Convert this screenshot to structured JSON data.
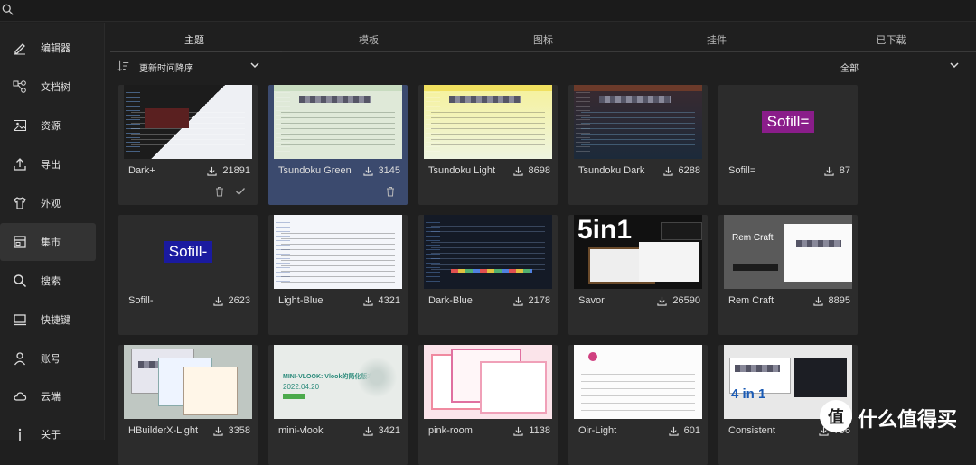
{
  "sidebar": {
    "items": [
      {
        "label": "编辑器",
        "icon": "edit-icon"
      },
      {
        "label": "文档树",
        "icon": "tree-icon"
      },
      {
        "label": "资源",
        "icon": "image-icon"
      },
      {
        "label": "导出",
        "icon": "export-icon"
      },
      {
        "label": "外观",
        "icon": "appearance-icon"
      },
      {
        "label": "集市",
        "icon": "market-icon",
        "active": true
      },
      {
        "label": "搜索",
        "icon": "search-icon"
      },
      {
        "label": "快捷键",
        "icon": "keyboard-icon"
      },
      {
        "label": "账号",
        "icon": "user-icon"
      },
      {
        "label": "云端",
        "icon": "cloud-icon"
      },
      {
        "label": "关于",
        "icon": "info-icon"
      }
    ]
  },
  "tabs": [
    "主题",
    "模板",
    "图标",
    "挂件",
    "已下载"
  ],
  "sortbar": {
    "sort_label": "更新时间降序",
    "filter_label": "全部"
  },
  "cards": [
    {
      "name": "Dark+",
      "downloads": "21891"
    },
    {
      "name": "Tsundoku Green",
      "downloads": "3145"
    },
    {
      "name": "Tsundoku Light",
      "downloads": "8698"
    },
    {
      "name": "Tsundoku Dark",
      "downloads": "6288"
    },
    {
      "name": "Sofill=",
      "downloads": "87",
      "badge": "Sofill="
    },
    {
      "name": "Sofill-",
      "downloads": "2623",
      "badge": "Sofill-"
    },
    {
      "name": "Light-Blue",
      "downloads": "4321"
    },
    {
      "name": "Dark-Blue",
      "downloads": "2178"
    },
    {
      "name": "Savor",
      "downloads": "26590",
      "thumb_text": "5in1"
    },
    {
      "name": "Rem Craft",
      "downloads": "8895",
      "thumb_text": "Rem Craft"
    },
    {
      "name": "HBuilderX-Light",
      "downloads": "3358"
    },
    {
      "name": "mini-vlook",
      "downloads": "3421",
      "thumb_text": "MINI-VLOOK: Vlook的简化版本",
      "thumb_date": "2022.04.20"
    },
    {
      "name": "pink-room",
      "downloads": "1138"
    },
    {
      "name": "Oir-Light",
      "downloads": "601"
    },
    {
      "name": "Consistent",
      "downloads": "796",
      "thumb_text": "4 in 1"
    }
  ],
  "watermark": {
    "circle": "值",
    "text": "什么值得买"
  }
}
